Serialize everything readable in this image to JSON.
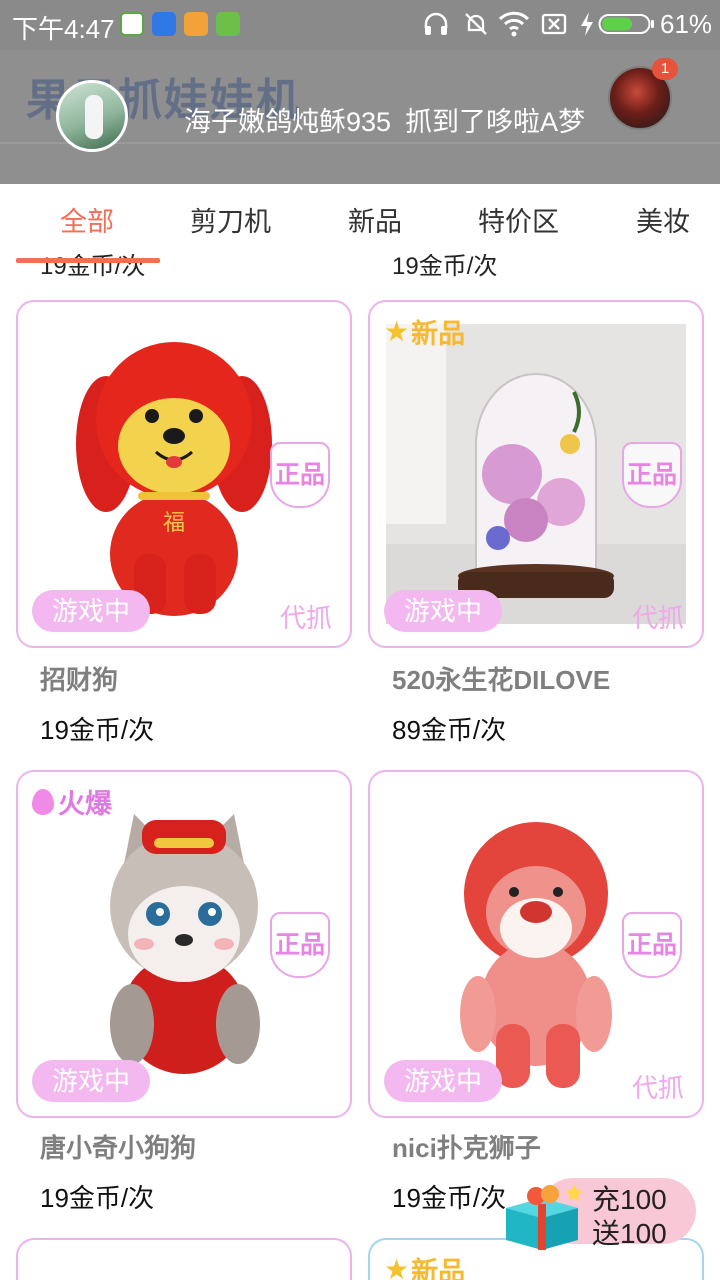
{
  "status_bar": {
    "time": "下午4:47",
    "battery": "61%"
  },
  "header": {
    "logo": "果果抓娃娃机",
    "ticker_user": "海子嫩鸽炖稣935",
    "ticker_action": "抓到了哆啦A梦",
    "notification_count": "1"
  },
  "tabs": [
    {
      "label": "全部"
    },
    {
      "label": "剪刀机"
    },
    {
      "label": "新品"
    },
    {
      "label": "特价区"
    },
    {
      "label": "美妆"
    }
  ],
  "prev_row_prices": [
    "19金币/次",
    "19金币/次"
  ],
  "products": [
    {
      "name": "招财狗",
      "price": "19金币/次",
      "genuine": "正品",
      "status": "游戏中",
      "proxy": "代抓",
      "tag": ""
    },
    {
      "name": "520永生花DILOVE",
      "price": "89金币/次",
      "genuine": "正品",
      "status": "游戏中",
      "proxy": "代抓",
      "tag": "新品"
    },
    {
      "name": "唐小奇小狗狗",
      "price": "19金币/次",
      "genuine": "正品",
      "status": "游戏中",
      "proxy": "",
      "tag": "火爆"
    },
    {
      "name": "nici扑克狮子",
      "price": "19金币/次",
      "genuine": "正品",
      "status": "游戏中",
      "proxy": "代抓",
      "tag": ""
    }
  ],
  "next_row_tag": "新品",
  "recharge": {
    "line1": "充100",
    "line2": "送100"
  },
  "colors": {
    "accent": "#f26e57",
    "card_border": "#eab3ec",
    "status_pill": "#f2b8ef"
  }
}
